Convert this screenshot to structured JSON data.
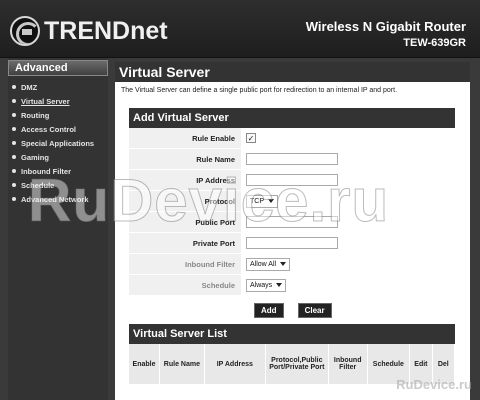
{
  "brand": {
    "logo_text": "TRENDnet"
  },
  "product": {
    "name": "Wireless N Gigabit Router",
    "model": "TEW-639GR"
  },
  "sidebar": {
    "heading": "Advanced",
    "items": [
      {
        "label": "DMZ"
      },
      {
        "label": "Virtual Server",
        "active": true
      },
      {
        "label": "Routing"
      },
      {
        "label": "Access Control"
      },
      {
        "label": "Special Applications"
      },
      {
        "label": "Gaming"
      },
      {
        "label": "Inbound Filter"
      },
      {
        "label": "Schedule"
      },
      {
        "label": "Advanced Network"
      }
    ]
  },
  "main": {
    "title": "Virtual Server",
    "description": "The Virtual Server can define a single public port for redirection to an internal IP and port."
  },
  "form": {
    "heading": "Add Virtual Server",
    "rule_enable": {
      "label": "Rule Enable",
      "checked": true,
      "mark": "✓"
    },
    "rule_name": {
      "label": "Rule Name",
      "value": ""
    },
    "ip_address": {
      "label": "IP Address",
      "value": ""
    },
    "protocol": {
      "label": "Protocol",
      "value": "TCP"
    },
    "public_port": {
      "label": "Public Port",
      "value": ""
    },
    "private_port": {
      "label": "Private Port",
      "value": ""
    },
    "inbound_filter": {
      "label": "Inbound Filter",
      "value": "Allow All"
    },
    "schedule": {
      "label": "Schedule",
      "value": "Always"
    },
    "add_label": "Add",
    "clear_label": "Clear"
  },
  "list": {
    "heading": "Virtual Server List",
    "columns": [
      "Enable",
      "Rule Name",
      "IP Address",
      "Protocol,Public Port/Private Port",
      "Inbound Filter",
      "Schedule",
      "Edit",
      "Del"
    ]
  },
  "watermark": {
    "main": "RuDevice.ru",
    "corner": "RuDevice.ru"
  }
}
